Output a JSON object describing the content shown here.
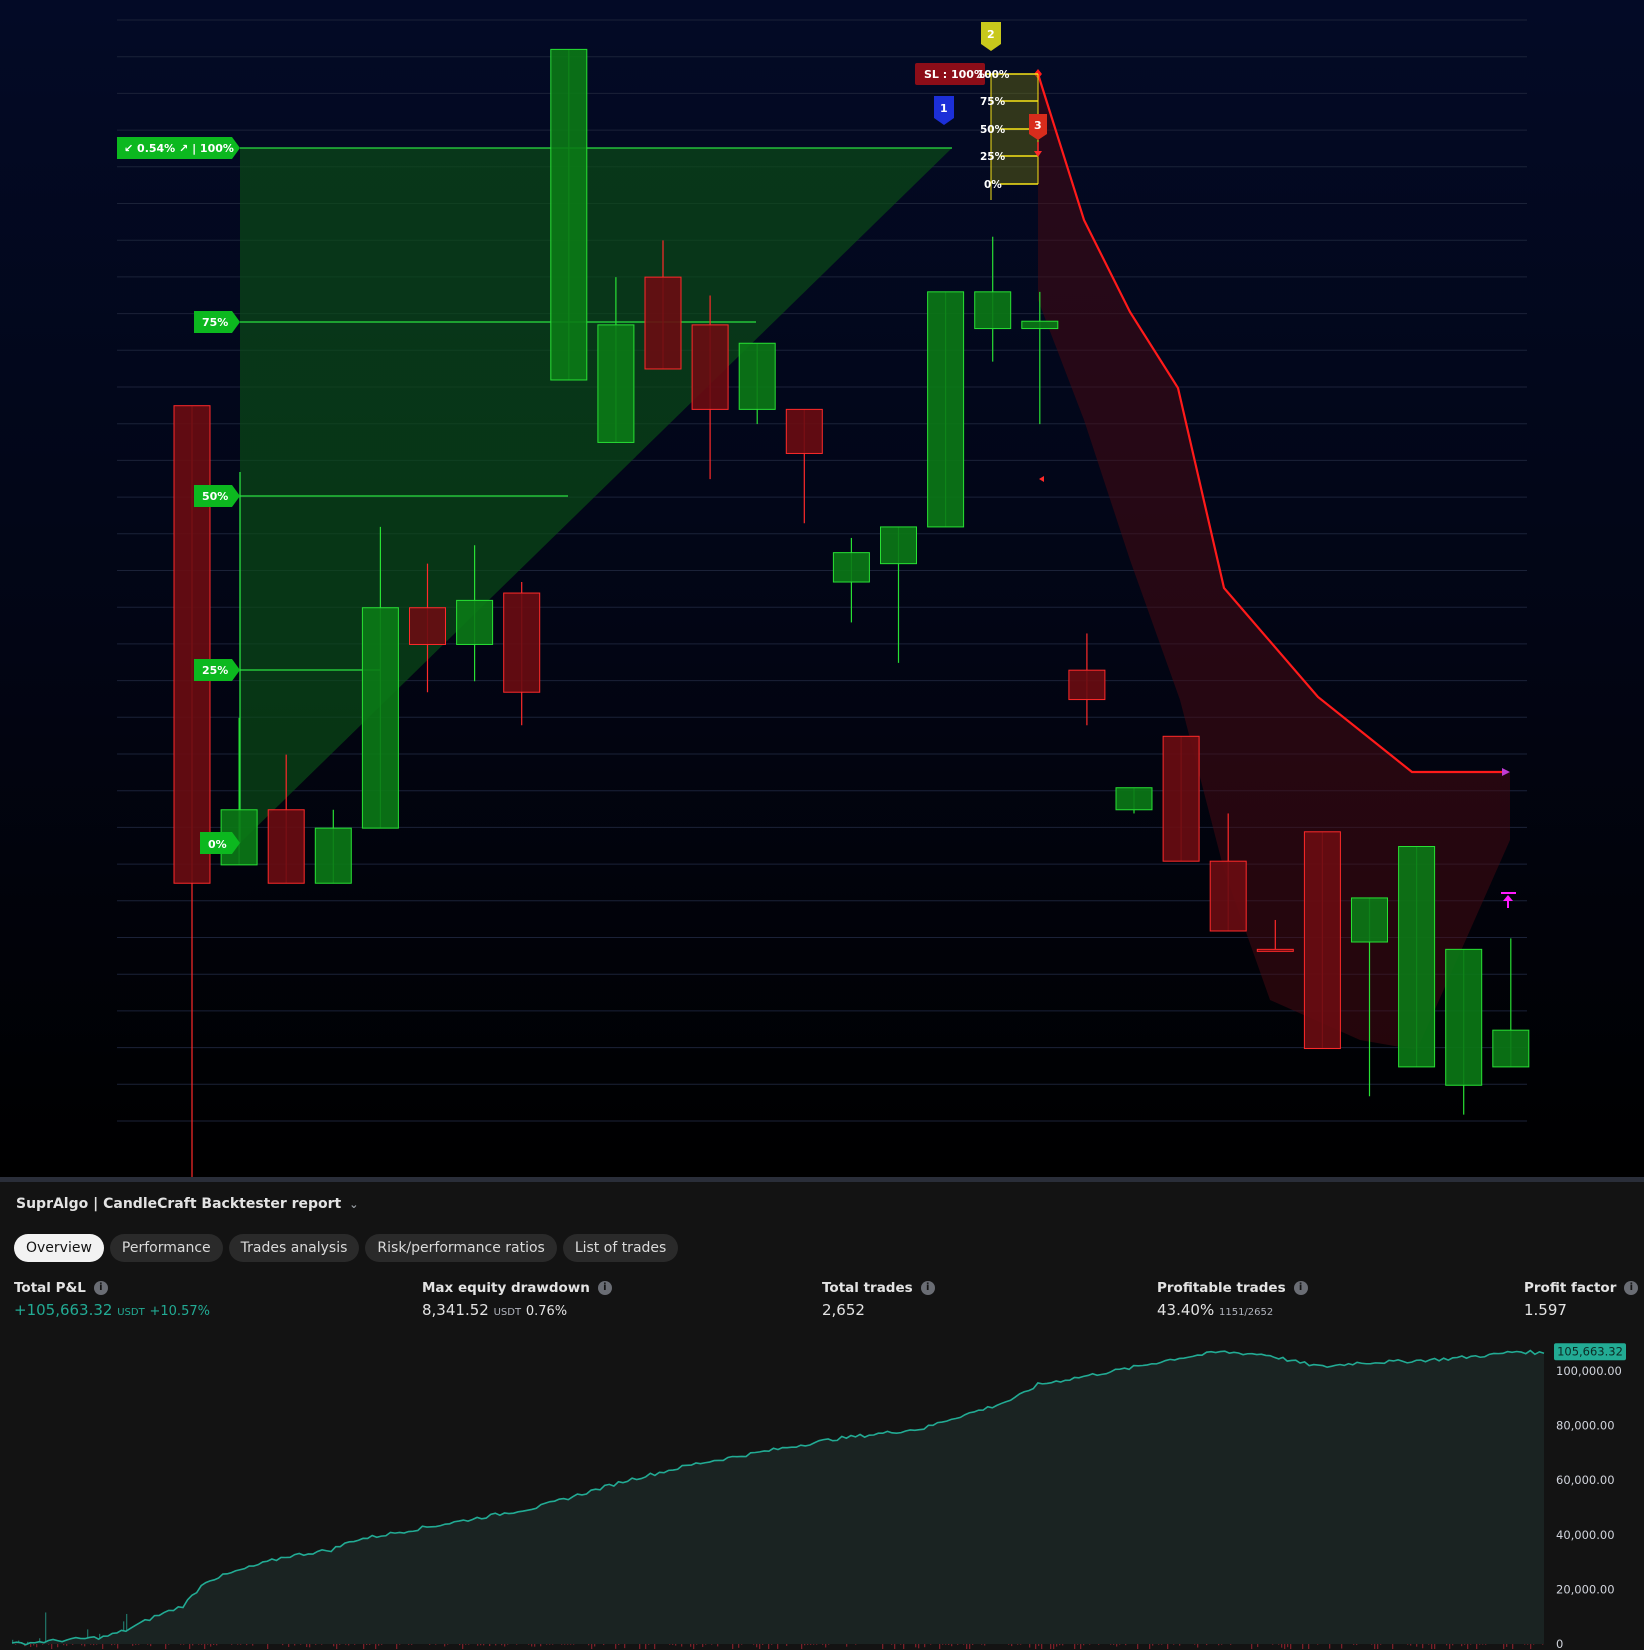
{
  "chart": {
    "entry_fib": {
      "label_top": "↙ 0.54% ↗ | 100%",
      "levels": [
        "75%",
        "50%",
        "25%",
        "0%"
      ]
    },
    "short_fib": {
      "sl_label": "SL : 100%",
      "levels": [
        "100%",
        "75%",
        "50%",
        "25%",
        "0%"
      ]
    },
    "markers": [
      "1",
      "2",
      "3"
    ],
    "colors": {
      "bull": "#0b7a16",
      "bull_border": "#28e034",
      "bear": "#6a0c12",
      "bear_border": "#ff2a2a",
      "trail": "#ff1a1a"
    },
    "chart_data": {
      "type": "candlestick",
      "candles": [
        {
          "o": 295,
          "h": 185,
          "c": 165,
          "l": 85
        },
        {
          "o": 170,
          "h": 190,
          "c": 185,
          "l": 210
        },
        {
          "o": 185,
          "h": 200,
          "c": 165,
          "l": 195
        },
        {
          "o": 165,
          "h": 185,
          "c": 180,
          "l": 175
        },
        {
          "o": 180,
          "h": 262,
          "c": 240,
          "l": 220
        },
        {
          "o": 240,
          "h": 252,
          "c": 230,
          "l": 217
        },
        {
          "o": 230,
          "h": 257,
          "c": 242,
          "l": 220
        },
        {
          "o": 244,
          "h": 247,
          "c": 217,
          "l": 208
        },
        {
          "o": 302,
          "h": 315,
          "c": 392,
          "l": 330
        },
        {
          "o": 285,
          "h": 330,
          "c": 317,
          "l": 323
        },
        {
          "o": 330,
          "h": 336,
          "c": 305,
          "l": 340
        },
        {
          "o": 317,
          "h": 325,
          "c": 294,
          "l": 275
        },
        {
          "o": 294,
          "h": 290,
          "c": 312,
          "l": 300
        },
        {
          "o": 294,
          "h": 294,
          "c": 282,
          "l": 263
        },
        {
          "o": 247,
          "h": 259,
          "c": 255,
          "l": 236
        },
        {
          "o": 252,
          "h": 257,
          "c": 262,
          "l": 225
        },
        {
          "o": 262,
          "h": 270,
          "c": 326,
          "l": 284
        },
        {
          "o": 316,
          "h": 341,
          "c": 326,
          "l": 307
        },
        {
          "o": 316,
          "h": 326,
          "c": 318,
          "l": 290
        },
        {
          "o": 223,
          "h": 233,
          "c": 215,
          "l": 208
        },
        {
          "o": 185,
          "h": 189,
          "c": 191,
          "l": 184
        },
        {
          "o": 205,
          "h": 184,
          "c": 171,
          "l": 179
        },
        {
          "o": 171,
          "h": 183,
          "c": 152,
          "l": 184
        },
        {
          "o": 147,
          "h": 152,
          "c": 147,
          "l": 155
        },
        {
          "o": 179,
          "h": 151,
          "c": 120,
          "l": 137
        },
        {
          "o": 149,
          "h": 143,
          "c": 161,
          "l": 107
        },
        {
          "o": 115,
          "h": 165,
          "c": 175,
          "l": 127
        },
        {
          "o": 110,
          "h": 115,
          "c": 147,
          "l": 102
        },
        {
          "o": 115,
          "h": 143,
          "c": 125,
          "l": 150
        }
      ]
    }
  },
  "report": {
    "title": "SuprAlgo | CandleCraft Backtester report",
    "tabs": [
      "Overview",
      "Performance",
      "Trades analysis",
      "Risk/performance ratios",
      "List of trades"
    ],
    "active_tab": "Overview",
    "stats": {
      "total_pnl": {
        "label": "Total P&L",
        "value": "+105,663.32",
        "unit": "USDT",
        "pct": "+10.57%"
      },
      "max_dd": {
        "label": "Max equity drawdown",
        "value": "8,341.52",
        "unit": "USDT",
        "pct": "0.76%"
      },
      "total_trades": {
        "label": "Total trades",
        "value": "2,652"
      },
      "profitable": {
        "label": "Profitable trades",
        "value": "43.40%",
        "detail": "1151/2652"
      },
      "profit_factor": {
        "label": "Profit factor",
        "value": "1.597"
      }
    },
    "equity_chart": {
      "type": "area",
      "current_value_label": "105,663.32",
      "y_ticks": [
        "100,000.00",
        "80,000.00",
        "60,000.00",
        "40,000.00",
        "20,000.00",
        "0"
      ],
      "ylim": [
        0,
        110000
      ],
      "colors": {
        "line": "#22ab94",
        "fill": "#1a2322",
        "badge": "#22ab94"
      },
      "points": [
        [
          0,
          0
        ],
        [
          80,
          2500
        ],
        [
          100,
          5000
        ],
        [
          125,
          10000
        ],
        [
          150,
          14000
        ],
        [
          170,
          23000
        ],
        [
          200,
          27000
        ],
        [
          240,
          32000
        ],
        [
          280,
          34500
        ],
        [
          300,
          38000
        ],
        [
          340,
          41000
        ],
        [
          380,
          44000
        ],
        [
          420,
          47000
        ],
        [
          460,
          50000
        ],
        [
          500,
          55000
        ],
        [
          540,
          60000
        ],
        [
          580,
          64000
        ],
        [
          600,
          66000
        ],
        [
          640,
          69000
        ],
        [
          680,
          72000
        ],
        [
          720,
          75000
        ],
        [
          760,
          77000
        ],
        [
          800,
          79000
        ],
        [
          820,
          82000
        ],
        [
          860,
          87000
        ],
        [
          880,
          90000
        ],
        [
          900,
          95000
        ],
        [
          940,
          98000
        ],
        [
          980,
          101000
        ],
        [
          1020,
          104500
        ],
        [
          1060,
          107000
        ],
        [
          1100,
          106000
        ],
        [
          1130,
          103000
        ],
        [
          1150,
          101500
        ],
        [
          1180,
          103000
        ],
        [
          1220,
          103500
        ],
        [
          1260,
          104500
        ],
        [
          1300,
          106000
        ],
        [
          1320,
          107200
        ],
        [
          1344,
          106500
        ]
      ]
    }
  }
}
